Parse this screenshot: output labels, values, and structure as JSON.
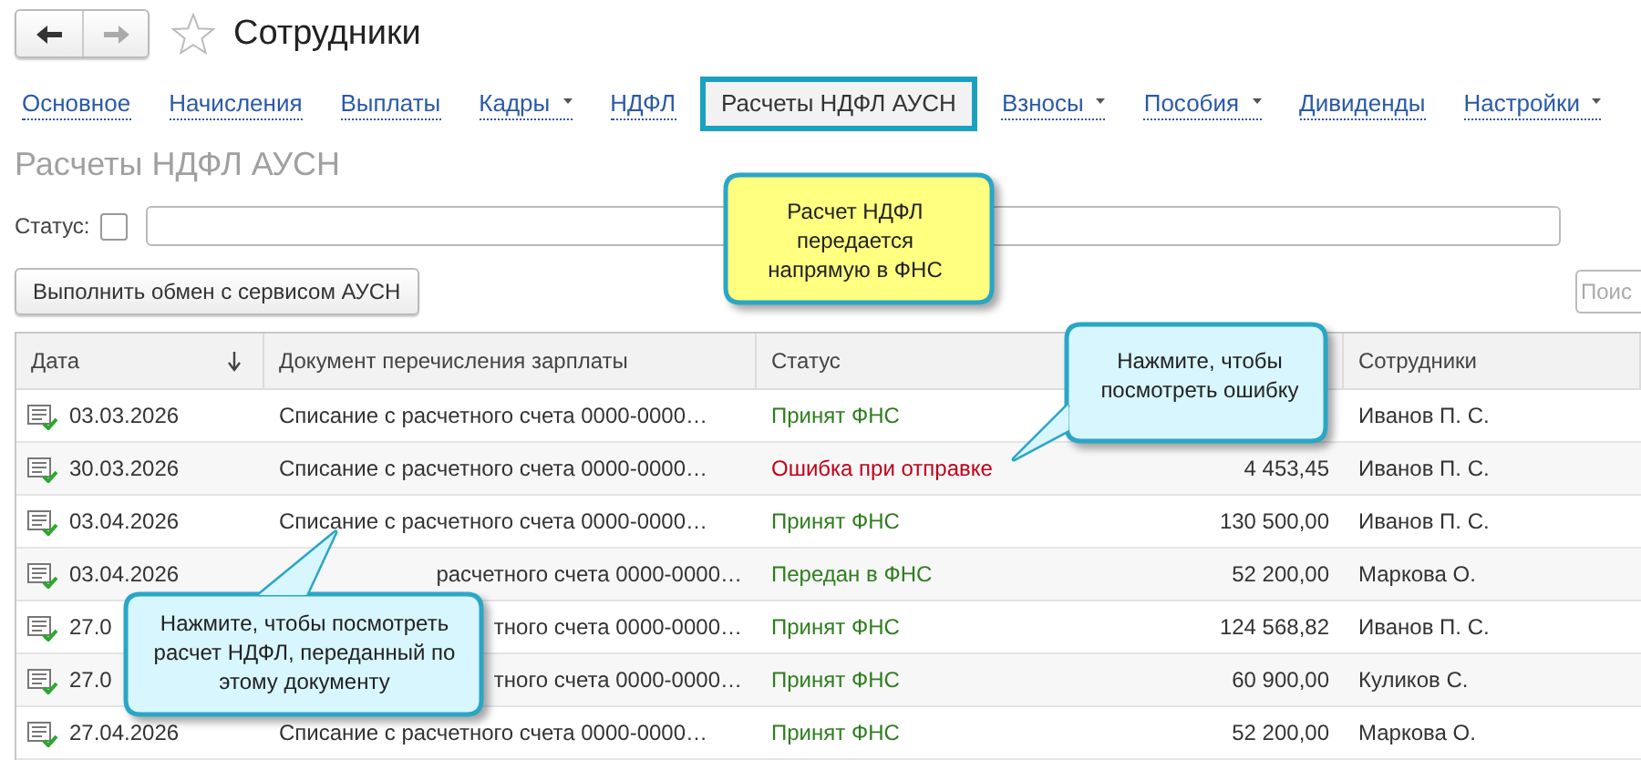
{
  "toolbar": {
    "title": "Сотрудники",
    "favorite": false
  },
  "tabs": [
    {
      "label": "Основное",
      "selected": false,
      "dropdown": false
    },
    {
      "label": "Начисления",
      "selected": false,
      "dropdown": false
    },
    {
      "label": "Выплаты",
      "selected": false,
      "dropdown": false
    },
    {
      "label": "Кадры",
      "selected": false,
      "dropdown": true
    },
    {
      "label": "НДФЛ",
      "selected": false,
      "dropdown": false
    },
    {
      "label": "Расчеты НДФЛ АУСН",
      "selected": true,
      "dropdown": false
    },
    {
      "label": "Взносы",
      "selected": false,
      "dropdown": true
    },
    {
      "label": "Пособия",
      "selected": false,
      "dropdown": true
    },
    {
      "label": "Дивиденды",
      "selected": false,
      "dropdown": false
    },
    {
      "label": "Настройки",
      "selected": false,
      "dropdown": true
    }
  ],
  "section_title": "Расчеты НДФЛ АУСН",
  "filter": {
    "label": "Статус:",
    "checked": false
  },
  "exchange_button": "Выполнить обмен с сервисом АУСН",
  "search": {
    "placeholder": "Поис"
  },
  "table": {
    "columns": [
      {
        "label": "Дата",
        "sorted": true
      },
      {
        "label": "Документ перечисления зарплаты",
        "sorted": false
      },
      {
        "label": "Статус",
        "sorted": false
      },
      {
        "label": "Сотрудники",
        "sorted": false
      }
    ],
    "rows": [
      {
        "date": "03.03.2026",
        "document": "Списание с расчетного счета 0000-0000…",
        "status": "Принят ФНС",
        "color": "#2e7d1e",
        "employee": "Иванов П. С."
      },
      {
        "date": "30.03.2026",
        "document": "Списание с расчетного счета 0000-0000…",
        "status": "Ошибка при отправке",
        "color": "#c00018",
        "amount": "4 453,45",
        "employee": "Иванов П. С."
      },
      {
        "date": "03.04.2026",
        "document": "Списание с расчетного счета 0000-0000…",
        "status": "Принят ФНС",
        "color": "#2e7d1e",
        "amount": "130 500,00",
        "employee": "Иванов П. С."
      },
      {
        "date": "03.04.2026",
        "document": "расчетного счета 0000-0000…",
        "status": "Передан в ФНС",
        "color": "#2e7d1e",
        "amount": "52 200,00",
        "employee": "Маркова О."
      },
      {
        "date": "27.0",
        "document": "тного счета 0000-0000…",
        "status": "Принят ФНС",
        "color": "#2e7d1e",
        "amount": "124 568,82",
        "employee": "Иванов П. С."
      },
      {
        "date": "27.0",
        "document": "тного счета 0000-0000…",
        "status": "Принят ФНС",
        "color": "#2e7d1e",
        "amount": "60 900,00",
        "employee": "Куликов С."
      },
      {
        "date": "27.04.2026",
        "document": "Списание с расчетного счета 0000-0000…",
        "status": "Принят ФНС",
        "color": "#2e7d1e",
        "amount": "52 200,00",
        "employee": "Маркова О."
      }
    ]
  },
  "callouts": [
    {
      "text": "Расчет НДФЛ передается напрямую в ФНС",
      "kind": "note"
    },
    {
      "text": "Нажмите, чтобы посмотреть ошибку",
      "kind": "hint"
    },
    {
      "text": "Нажмите, чтобы посмотреть расчет НДФЛ, переданный по этому документу",
      "kind": "hint"
    }
  ]
}
